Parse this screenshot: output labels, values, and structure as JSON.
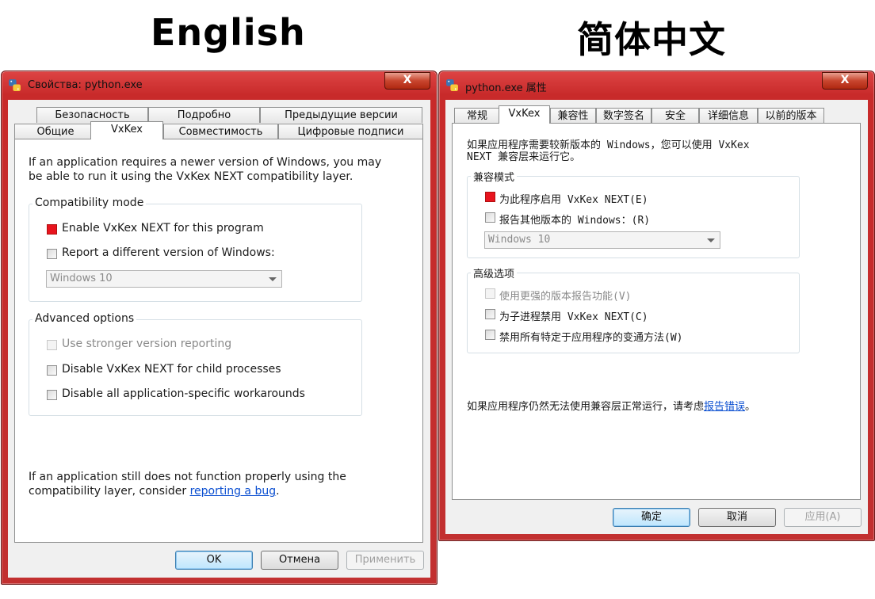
{
  "headings": {
    "english": "English",
    "chinese": "简体中文"
  },
  "colors": {
    "window_frame": "#c82a2a",
    "enabled_checkbox": "#e8141e",
    "link": "#0b4fd1"
  },
  "en": {
    "title": "Свойства: python.exe",
    "close": "X",
    "tabs_row1": [
      "Безопасность",
      "Подробно",
      "Предыдущие версии"
    ],
    "tabs_row2": [
      "Общие",
      "VxKex",
      "Совместимость",
      "Цифровые подписи"
    ],
    "intro_line1": "If an application requires a newer version of Windows, you may",
    "intro_line2": "be able to run it using the VxKex NEXT compatibility layer.",
    "compat_title": "Compatibility mode",
    "enable_label": "Enable VxKex NEXT for this program",
    "report_label": "Report a different version of Windows:",
    "combo_value": "Windows 10",
    "advanced_title": "Advanced options",
    "stronger_label": "Use stronger version reporting",
    "child_label": "Disable VxKex NEXT for child processes",
    "workaround_label": "Disable all application-specific workarounds",
    "footer_line1": "If an application still does not function properly using the",
    "footer_line2_prefix": "compatibility layer, consider ",
    "footer_link": "reporting a bug",
    "footer_suffix": ".",
    "ok": "OK",
    "cancel": "Отмена",
    "apply": "Применить"
  },
  "zh": {
    "title": "python.exe 属性",
    "close": "X",
    "tabs": [
      "常规",
      "VxKex",
      "兼容性",
      "数字签名",
      "安全",
      "详细信息",
      "以前的版本"
    ],
    "intro_line1": "如果应用程序需要较新版本的 Windows，您可以使用 VxKex",
    "intro_line2": "NEXT 兼容层来运行它。",
    "compat_title": "兼容模式",
    "enable_label": "为此程序启用 VxKex NEXT(E)",
    "report_label": "报告其他版本的 Windows：(R)",
    "combo_value": "Windows 10",
    "advanced_title": "高级选项",
    "stronger_label": "使用更强的版本报告功能(V)",
    "child_label": "为子进程禁用 VxKex NEXT(C)",
    "workaround_label": "禁用所有特定于应用程序的变通方法(W)",
    "footer_prefix": "如果应用程序仍然无法使用兼容层正常运行，请考虑",
    "footer_link": "报告错误",
    "footer_suffix": "。",
    "ok": "确定",
    "cancel": "取消",
    "apply": "应用(A)"
  }
}
